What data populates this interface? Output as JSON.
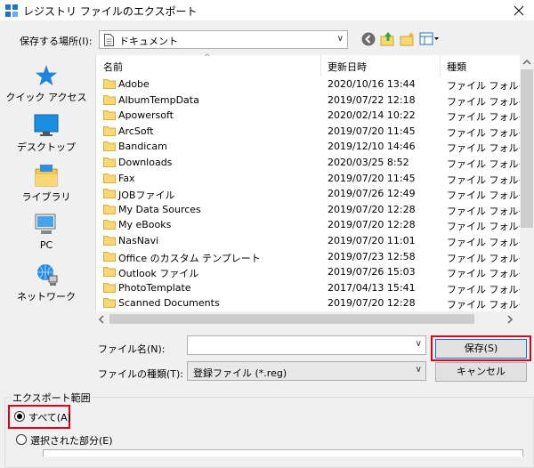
{
  "window": {
    "title": "レジストリ ファイルのエクスポート"
  },
  "location": {
    "label": "保存する場所(I):",
    "current": "ドキュメント"
  },
  "places": [
    {
      "label": "クイック アクセス",
      "icon": "quick-access-star-icon"
    },
    {
      "label": "デスクトップ",
      "icon": "desktop-icon"
    },
    {
      "label": "ライブラリ",
      "icon": "libraries-icon"
    },
    {
      "label": "PC",
      "icon": "pc-icon"
    },
    {
      "label": "ネットワーク",
      "icon": "network-icon"
    }
  ],
  "columns": {
    "name": "名前",
    "date": "更新日時",
    "type": "種類"
  },
  "files": [
    {
      "name": "Adobe",
      "date": "2020/10/16 13:44",
      "type": "ファイル フォルダー"
    },
    {
      "name": "AlbumTempData",
      "date": "2019/07/22 12:18",
      "type": "ファイル フォルダー"
    },
    {
      "name": "Apowersoft",
      "date": "2020/02/14 10:22",
      "type": "ファイル フォルダー"
    },
    {
      "name": "ArcSoft",
      "date": "2019/07/20 11:45",
      "type": "ファイル フォルダー"
    },
    {
      "name": "Bandicam",
      "date": "2019/12/10 14:46",
      "type": "ファイル フォルダー"
    },
    {
      "name": "Downloads",
      "date": "2020/03/25 8:52",
      "type": "ファイル フォルダー"
    },
    {
      "name": "Fax",
      "date": "2019/07/20 11:45",
      "type": "ファイル フォルダー"
    },
    {
      "name": "JOBファイル",
      "date": "2019/07/26 12:49",
      "type": "ファイル フォルダー"
    },
    {
      "name": "My Data Sources",
      "date": "2019/07/20 12:28",
      "type": "ファイル フォルダー"
    },
    {
      "name": "My eBooks",
      "date": "2019/07/20 12:28",
      "type": "ファイル フォルダー"
    },
    {
      "name": "NasNavi",
      "date": "2019/07/20 11:01",
      "type": "ファイル フォルダー"
    },
    {
      "name": "Office のカスタム テンプレート",
      "date": "2019/07/23 12:58",
      "type": "ファイル フォルダー"
    },
    {
      "name": "Outlook ファイル",
      "date": "2019/07/26 15:03",
      "type": "ファイル フォルダー"
    },
    {
      "name": "PhotoTemplate",
      "date": "2017/04/13 15:41",
      "type": "ファイル フォルダー"
    },
    {
      "name": "Scanned Documents",
      "date": "2019/07/20 12:28",
      "type": "ファイル フォルダー"
    }
  ],
  "filename": {
    "label": "ファイル名(N):",
    "value": ""
  },
  "filetype": {
    "label": "ファイルの種類(T):",
    "value": "登録ファイル (*.reg)"
  },
  "buttons": {
    "save": "保存(S)",
    "cancel": "キャンセル"
  },
  "export_range": {
    "label": "エクスポート範囲",
    "all": "すべて(A)",
    "selected": "選択された部分(E)",
    "all_checked": true
  },
  "colors": {
    "folder": "#f8d775",
    "highlight": "#e0001a",
    "accent": "#0078d7"
  }
}
